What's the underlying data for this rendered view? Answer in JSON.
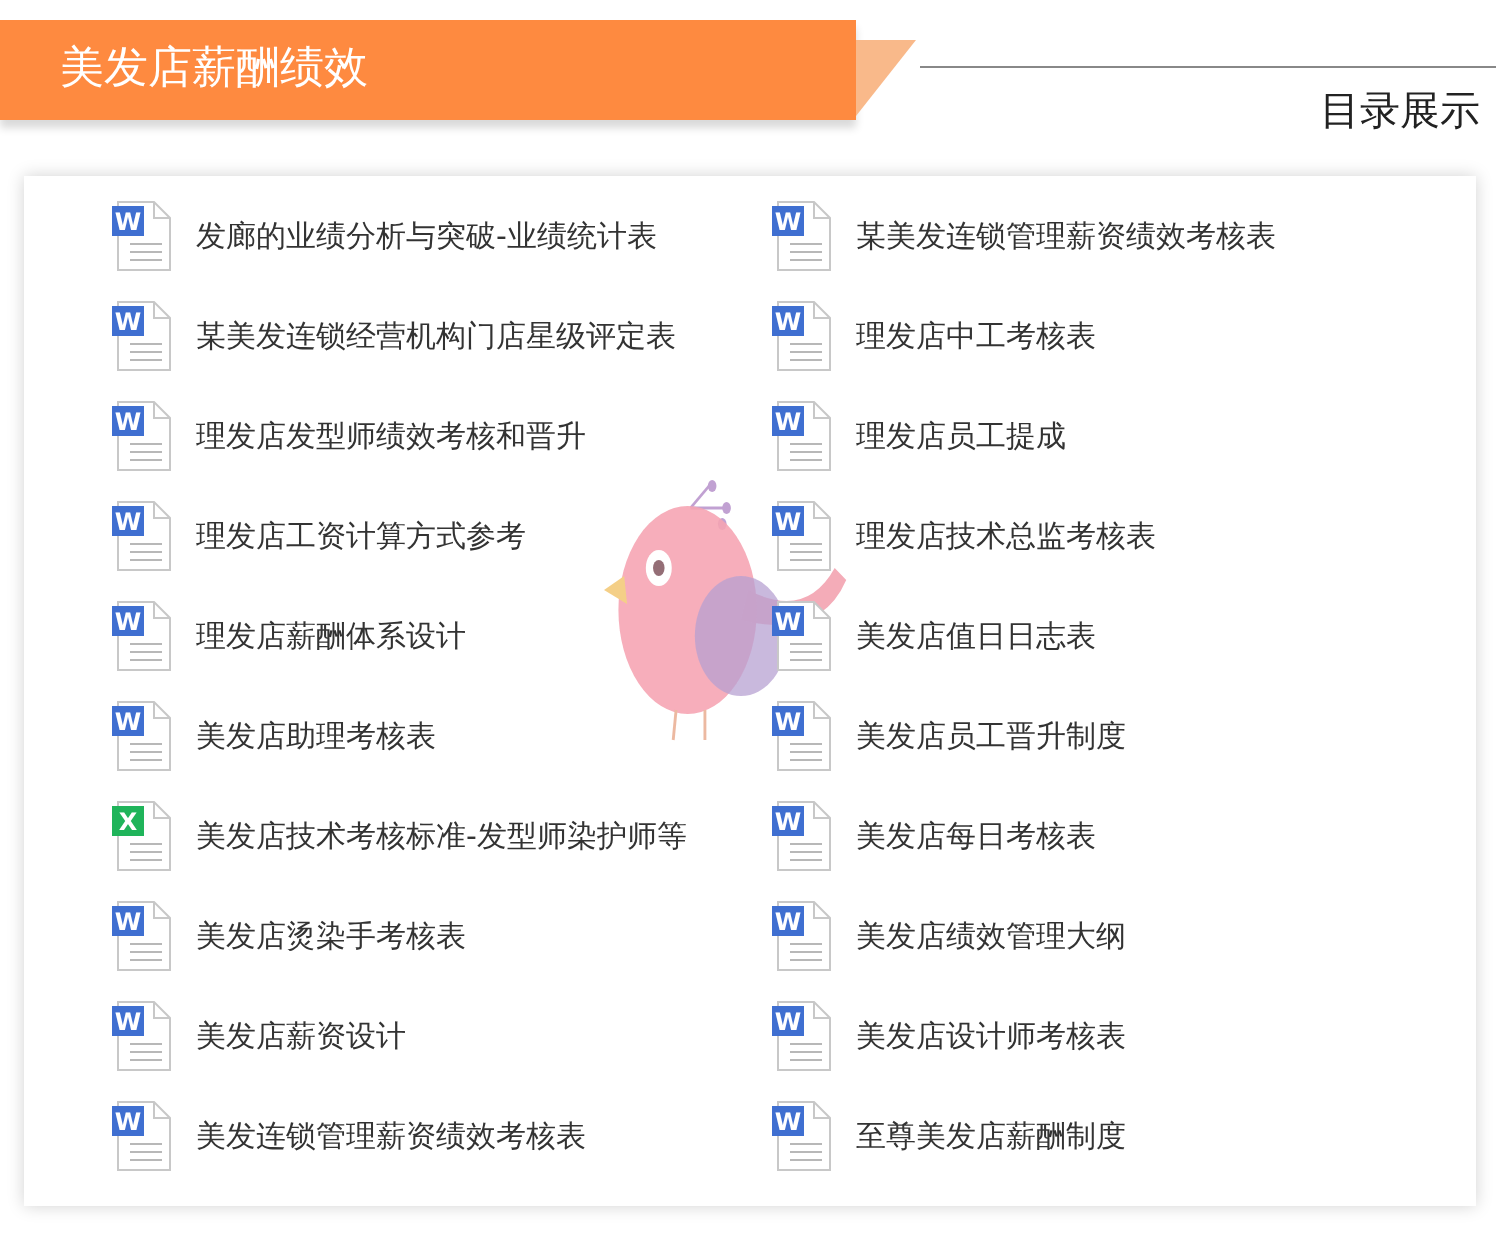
{
  "header": {
    "title": "美发店薪酬绩效",
    "subtitle": "目录展示"
  },
  "files": [
    {
      "name": "发廊的业绩分析与突破-业绩统计表",
      "kind": "word",
      "letter": "W"
    },
    {
      "name": "某美发连锁管理薪资绩效考核表",
      "kind": "word",
      "letter": "W"
    },
    {
      "name": "某美发连锁经营机构门店星级评定表",
      "kind": "word",
      "letter": "W"
    },
    {
      "name": "理发店中工考核表",
      "kind": "word",
      "letter": "W"
    },
    {
      "name": "理发店发型师绩效考核和晋升",
      "kind": "word",
      "letter": "W"
    },
    {
      "name": "理发店员工提成",
      "kind": "word",
      "letter": "W"
    },
    {
      "name": "理发店工资计算方式参考",
      "kind": "word",
      "letter": "W"
    },
    {
      "name": "理发店技术总监考核表",
      "kind": "word",
      "letter": "W"
    },
    {
      "name": "理发店薪酬体系设计",
      "kind": "word",
      "letter": "W"
    },
    {
      "name": "美发店值日日志表",
      "kind": "word",
      "letter": "W"
    },
    {
      "name": "美发店助理考核表",
      "kind": "word",
      "letter": "W"
    },
    {
      "name": "美发店员工晋升制度",
      "kind": "word",
      "letter": "W"
    },
    {
      "name": "美发店技术考核标准-发型师染护师等",
      "kind": "excel",
      "letter": "X"
    },
    {
      "name": "美发店每日考核表",
      "kind": "word",
      "letter": "W"
    },
    {
      "name": "美发店烫染手考核表",
      "kind": "word",
      "letter": "W"
    },
    {
      "name": "美发店绩效管理大纲",
      "kind": "word",
      "letter": "W"
    },
    {
      "name": "美发店薪资设计",
      "kind": "word",
      "letter": "W"
    },
    {
      "name": "美发店设计师考核表",
      "kind": "word",
      "letter": "W"
    },
    {
      "name": "美发连锁管理薪资绩效考核表",
      "kind": "word",
      "letter": "W"
    },
    {
      "name": "至尊美发店薪酬制度",
      "kind": "word",
      "letter": "W"
    }
  ]
}
